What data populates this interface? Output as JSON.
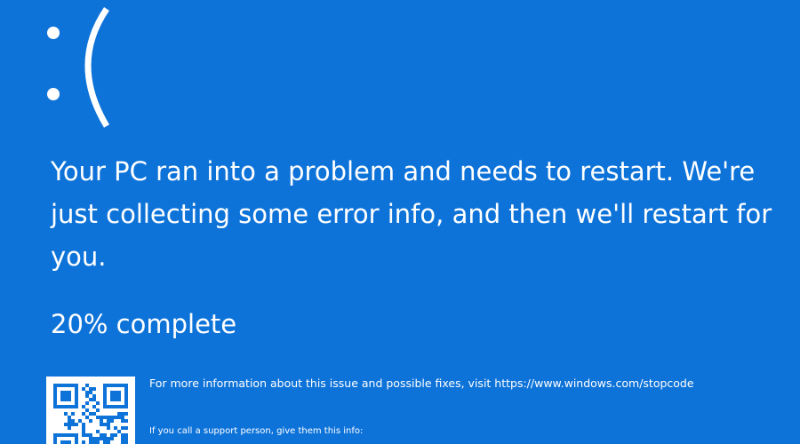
{
  "screen": {
    "background_color": "#0e73d9"
  },
  "sad_face": {
    "icon": "sad-face-icon",
    "text": ":("
  },
  "message": {
    "text": "Your PC ran into a problem and needs to restart. We're\njust collecting some error info, and then we'll restart for\nyou."
  },
  "progress": {
    "text": "20% complete",
    "percent": 20
  },
  "info": {
    "more_info_text": "For more information about this issue and possible fixes, visit https://www.windows.com/stopcode",
    "support_text": "If you call a support person, give them this info:"
  },
  "qr_code": {
    "icon": "qr-code-icon",
    "foreground_color": "#0e73d9"
  }
}
